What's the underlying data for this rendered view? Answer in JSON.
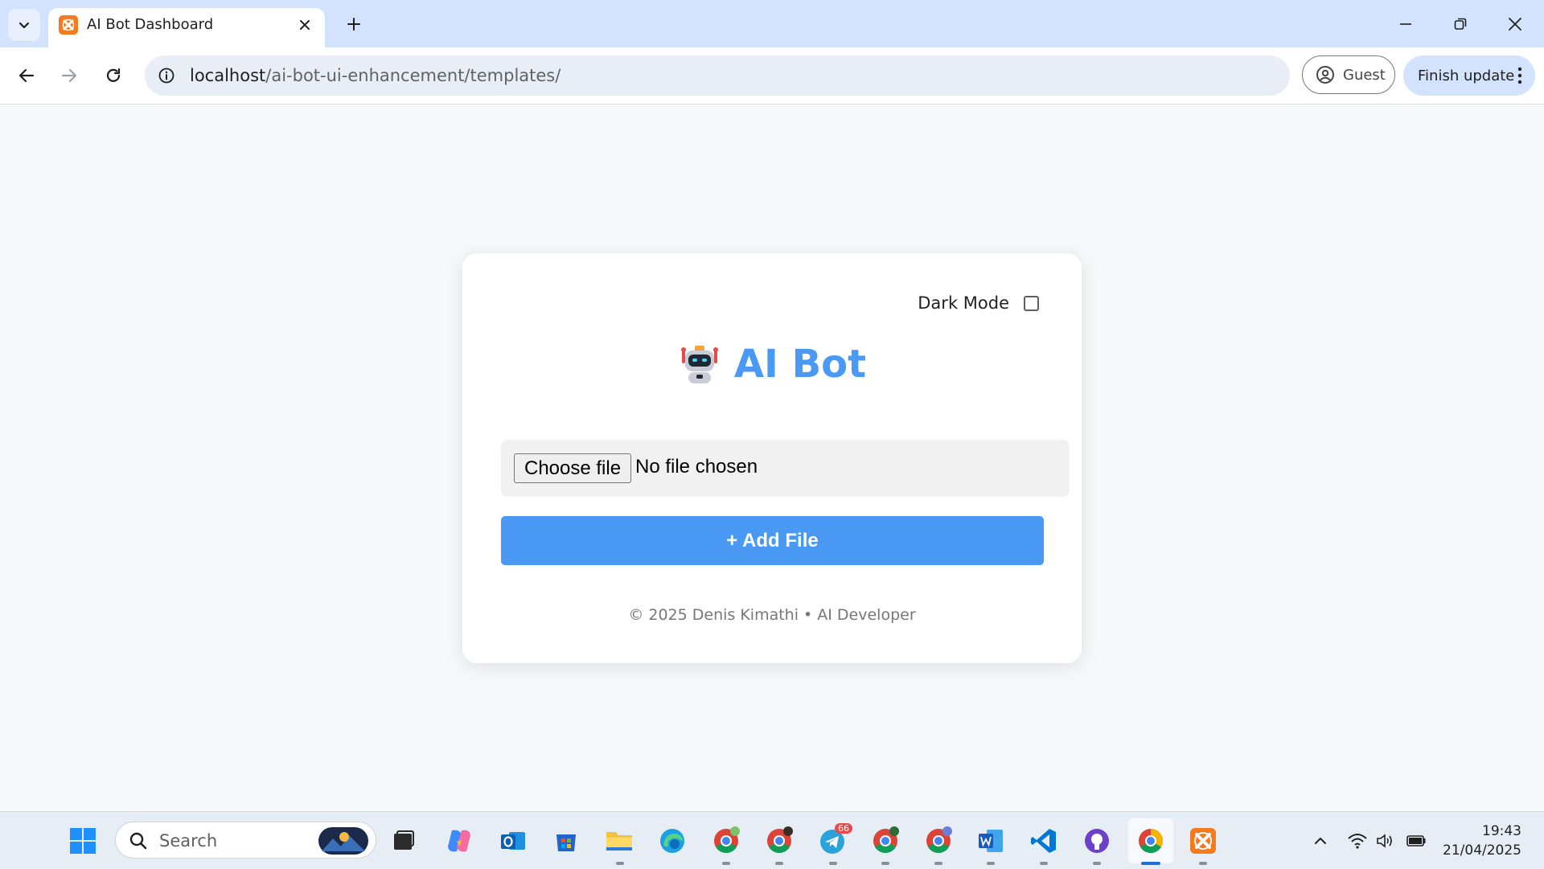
{
  "browser": {
    "tab_title": "AI Bot Dashboard",
    "url_host": "localhost",
    "url_path": "/ai-bot-ui-enhancement/templates/",
    "profile_label": "Guest",
    "update_label": "Finish update"
  },
  "page": {
    "dark_mode_label": "Dark Mode",
    "dark_mode_checked": false,
    "brand_title": "AI Bot",
    "choose_file_label": "Choose file",
    "no_file_text": "No file chosen",
    "add_file_label": "+ Add File",
    "footer_text": "© 2025 Denis Kimathi • AI Developer",
    "accent_color": "#4a9af5"
  },
  "taskbar": {
    "search_placeholder": "Search",
    "time": "19:43",
    "date": "21/04/2025",
    "telegram_badge": "66",
    "apps": [
      "start-icon",
      "task-view-icon",
      "copilot-icon",
      "outlook-icon",
      "store-icon",
      "file-explorer-icon",
      "edge-icon",
      "chrome-icon",
      "chrome-profile-icon",
      "telegram-icon",
      "chrome-m-icon",
      "chrome-m2-icon",
      "word-icon",
      "vscode-icon",
      "github-icon",
      "chrome-active-icon",
      "xampp-icon"
    ]
  }
}
